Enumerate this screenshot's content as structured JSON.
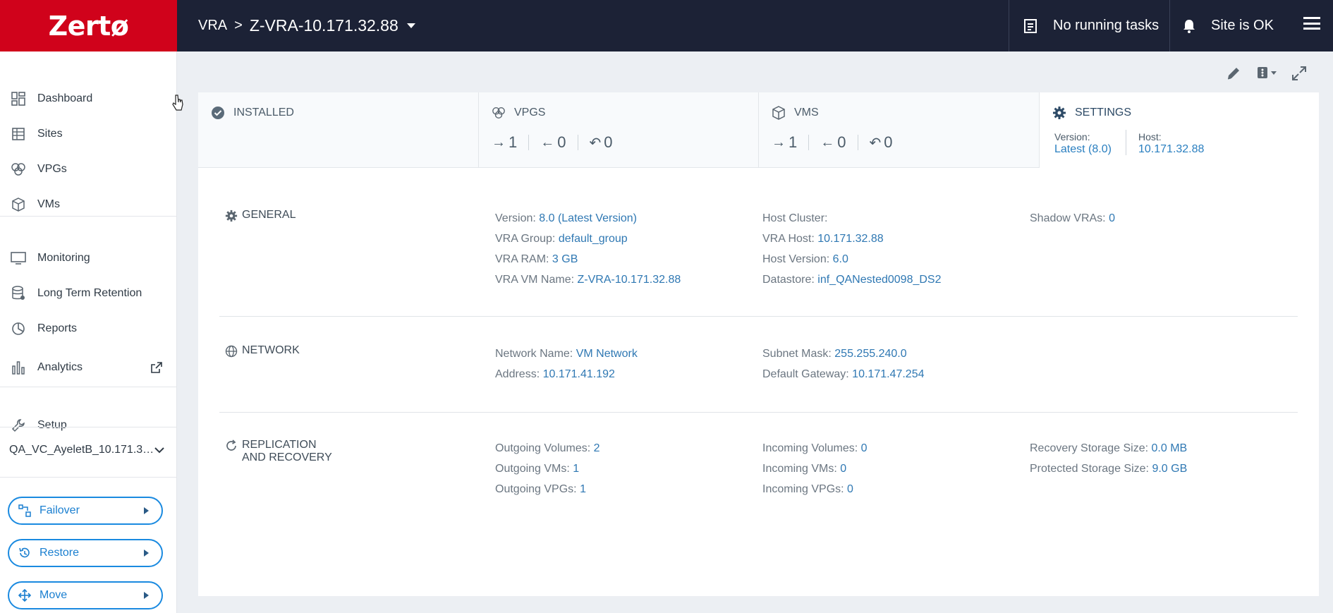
{
  "header": {
    "logo": "Zertø",
    "breadcrumb_root": "VRA",
    "breadcrumb_sep": ">",
    "breadcrumb_current": "Z-VRA-10.171.32.88",
    "tasks_label": "No running tasks",
    "site_status": "Site is OK"
  },
  "sidebar": {
    "items": [
      {
        "label": "Dashboard",
        "icon": "dashboard-icon"
      },
      {
        "label": "Sites",
        "icon": "sites-icon"
      },
      {
        "label": "VPGs",
        "icon": "vpgs-icon"
      },
      {
        "label": "VMs",
        "icon": "vms-icon"
      },
      {
        "label": "Monitoring",
        "icon": "monitor-icon"
      },
      {
        "label": "Long Term Retention",
        "icon": "database-icon"
      },
      {
        "label": "Reports",
        "icon": "pie-chart-icon"
      },
      {
        "label": "Analytics",
        "icon": "bar-chart-icon"
      },
      {
        "label": "Setup",
        "icon": "wrench-icon"
      }
    ],
    "site_selector": "QA_VC_AyeletB_10.171.3…",
    "actions": [
      {
        "label": "Failover"
      },
      {
        "label": "Restore"
      },
      {
        "label": "Move"
      }
    ]
  },
  "tabs": {
    "installed": "INSTALLED",
    "vpgs": {
      "title": "VPGS",
      "out": "1",
      "in": "0",
      "self": "0"
    },
    "vms": {
      "title": "VMS",
      "out": "1",
      "in": "0",
      "self": "0"
    },
    "settings": {
      "title": "SETTINGS",
      "version_label": "Version:",
      "version_value": "Latest (8.0)",
      "host_label": "Host:",
      "host_value": "10.171.32.88"
    }
  },
  "general": {
    "title": "GENERAL",
    "version": {
      "label": "Version: ",
      "value": "8.0 (Latest Version)"
    },
    "vra_group": {
      "label": "VRA Group: ",
      "value": "default_group"
    },
    "vra_ram": {
      "label": "VRA RAM: ",
      "value": "3 GB"
    },
    "vra_vm_name": {
      "label": "VRA VM Name: ",
      "value": "Z-VRA-10.171.32.88"
    },
    "host_cluster": {
      "label": "Host Cluster:",
      "value": ""
    },
    "vra_host": {
      "label": "VRA Host: ",
      "value": "10.171.32.88"
    },
    "host_version": {
      "label": "Host Version: ",
      "value": "6.0"
    },
    "datastore": {
      "label": "Datastore: ",
      "value": "inf_QANested0098_DS2"
    },
    "shadow_vras": {
      "label": "Shadow VRAs: ",
      "value": "0"
    }
  },
  "network": {
    "title": "NETWORK",
    "network_name": {
      "label": "Network Name: ",
      "value": "VM Network"
    },
    "address": {
      "label": "Address: ",
      "value": "10.171.41.192"
    },
    "subnet_mask": {
      "label": "Subnet Mask: ",
      "value": "255.255.240.0"
    },
    "default_gateway": {
      "label": "Default Gateway: ",
      "value": "10.171.47.254"
    }
  },
  "replication": {
    "title_line1": "REPLICATION",
    "title_line2": "AND RECOVERY",
    "outgoing_volumes": {
      "label": "Outgoing Volumes: ",
      "value": "2"
    },
    "outgoing_vms": {
      "label": "Outgoing VMs: ",
      "value": "1"
    },
    "outgoing_vpgs": {
      "label": "Outgoing VPGs: ",
      "value": "1"
    },
    "incoming_volumes": {
      "label": "Incoming Volumes: ",
      "value": "0"
    },
    "incoming_vms": {
      "label": "Incoming VMs: ",
      "value": "0"
    },
    "incoming_vpgs": {
      "label": "Incoming VPGs: ",
      "value": "0"
    },
    "recovery_storage": {
      "label": "Recovery Storage Size: ",
      "value": "0.0 MB"
    },
    "protected_storage": {
      "label": "Protected Storage Size: ",
      "value": "9.0 GB"
    }
  },
  "colors": {
    "brand": "#d0021b",
    "header_bg": "#1c2236",
    "accent": "#1a8ae0",
    "value_text": "#2f78b3"
  }
}
